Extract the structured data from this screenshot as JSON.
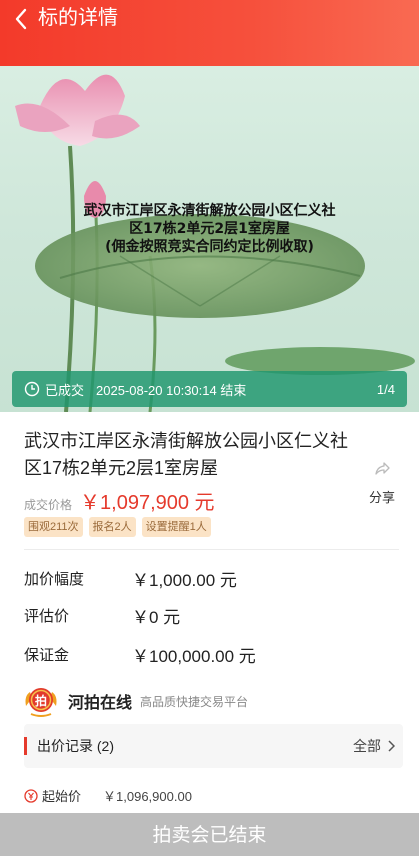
{
  "header": {
    "title": "标的详情"
  },
  "hero": {
    "overlay_lines": [
      "武汉市江岸区永清街解放公园小区仁义社",
      "区17栋2单元2层1室房屋",
      "(佣金按照竞实合同约定比例收取)"
    ],
    "status": "已成交",
    "end_time": "2025-08-20 10:30:14 结束",
    "page_indicator": "1/4"
  },
  "item": {
    "title": "武汉市江岸区永清街解放公园小区仁义社区17栋2单元2层1室房屋",
    "price_label": "成交价格",
    "price_value": "￥1,097,900 元",
    "share_label": "分享",
    "tags": [
      "围观211次",
      "报名2人",
      "设置提醒1人"
    ]
  },
  "details": [
    {
      "label": "加价幅度",
      "value": "￥1,000.00 元"
    },
    {
      "label": "评估价",
      "value": "￥0 元"
    },
    {
      "label": "保证金",
      "value": "￥100,000.00 元"
    }
  ],
  "org": {
    "logo_text": "拍",
    "name": "河拍在线",
    "desc": "高品质快捷交易平台"
  },
  "bids": {
    "title": "出价记录 (2)",
    "all_label": "全部"
  },
  "start": {
    "label": "起始价",
    "value": "￥1,096,900.00"
  },
  "footer": {
    "ended_label": "拍卖会已结束"
  },
  "colors": {
    "brand": "#f33a2a",
    "price": "#e53a2c",
    "hero_bar": "#1e966e",
    "tag_bg": "#fbe3c6"
  }
}
